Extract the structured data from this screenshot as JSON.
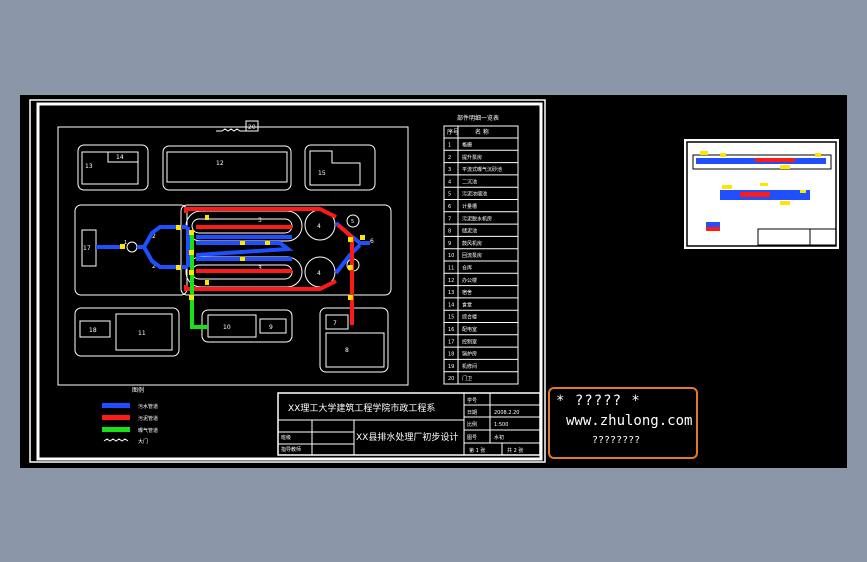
{
  "drawing": {
    "table_title": "部件明细一览表",
    "table_header": [
      "序号",
      "名 称"
    ],
    "components": [
      {
        "no": "1",
        "name": "格栅"
      },
      {
        "no": "2",
        "name": "提升泵房"
      },
      {
        "no": "3",
        "name": "平流式曝气沉砂池"
      },
      {
        "no": "4",
        "name": "二沉池"
      },
      {
        "no": "5",
        "name": "污泥浓缩池"
      },
      {
        "no": "6",
        "name": "计量槽"
      },
      {
        "no": "7",
        "name": "污泥脱水机房"
      },
      {
        "no": "8",
        "name": "储泥池"
      },
      {
        "no": "9",
        "name": "鼓风机房"
      },
      {
        "no": "10",
        "name": "回流泵房"
      },
      {
        "no": "11",
        "name": "仓库"
      },
      {
        "no": "12",
        "name": "办公楼"
      },
      {
        "no": "13",
        "name": "宿舍"
      },
      {
        "no": "14",
        "name": "食堂"
      },
      {
        "no": "15",
        "name": "综合楼"
      },
      {
        "no": "16",
        "name": "配电室"
      },
      {
        "no": "17",
        "name": "控制室"
      },
      {
        "no": "18",
        "name": "锅炉房"
      },
      {
        "no": "19",
        "name": "机修间"
      },
      {
        "no": "20",
        "name": "门卫"
      }
    ],
    "legend": {
      "title": "图例",
      "items": [
        {
          "label": "污水管道",
          "color": "#1f4fff"
        },
        {
          "label": "污泥管道",
          "color": "#ff1a1a"
        },
        {
          "label": "曝气管道",
          "color": "#19e019"
        },
        {
          "label": "大门",
          "color": "#ffffff"
        }
      ]
    },
    "title_block": {
      "school": "XX理工大学建筑工程学院市政工程系",
      "project": "XX县排水处理厂初步设计",
      "row_labels": [
        "班级",
        "指导教师"
      ],
      "info": [
        {
          "label": "学号",
          "value": ""
        },
        {
          "label": "日期",
          "value": "2008.2.20"
        },
        {
          "label": "比例",
          "value": "1:500"
        },
        {
          "label": "图号",
          "value": "水初"
        }
      ],
      "sheet": "第 1 张",
      "total": "共 2 张"
    },
    "buildings": {
      "b13": "13",
      "b14": "14",
      "b12": "12",
      "b15": "15",
      "b17": "17",
      "b18": "18",
      "b11": "11",
      "b10": "10",
      "b9": "9",
      "b7": "7",
      "b8": "8",
      "b20": "20",
      "b3a": "3",
      "b3b": "3",
      "b4a": "4",
      "b4b": "4",
      "b2a": "2",
      "b2b": "2",
      "b1": "1",
      "b6": "6",
      "b5a": "5",
      "b5b": "5"
    }
  },
  "watermark": {
    "line1": "* ????? *",
    "line2": "www.zhulong.com",
    "line3": "????????"
  }
}
